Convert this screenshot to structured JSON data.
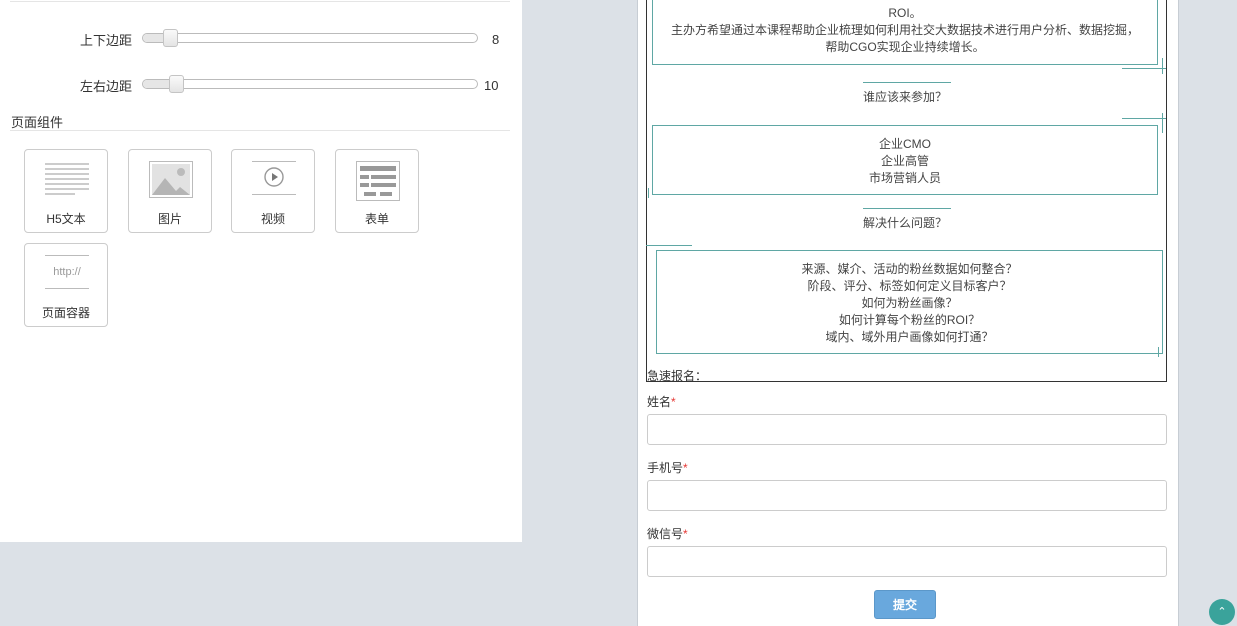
{
  "settings": {
    "vertical_margin": {
      "label": "上下边距",
      "value": "8",
      "level_percent": 8
    },
    "horizontal_margin": {
      "label": "左右边距",
      "value": "10",
      "level_percent": 10
    }
  },
  "components": {
    "title": "页面组件",
    "items": [
      {
        "label": "H5文本",
        "icon": "text-lines-icon"
      },
      {
        "label": "图片",
        "icon": "image-icon"
      },
      {
        "label": "视频",
        "icon": "video-play-icon"
      },
      {
        "label": "表单",
        "icon": "form-icon"
      },
      {
        "label": "页面容器",
        "icon": "browser-url-icon",
        "icon_text": "http://"
      }
    ]
  },
  "preview": {
    "intro_lines": [
      "ROI。",
      "主办方希望通过本课程帮助企业梳理如何利用社交大数据技术进行用户分析、数据挖掘，",
      "帮助CGO实现企业持续增长。"
    ],
    "who_heading": "谁应该来参加？",
    "who_lines": [
      "企业CMO",
      "企业高管",
      "市场营销人员"
    ],
    "problem_heading": "解决什么问题？",
    "problem_lines": [
      "来源、媒介、活动的粉丝数据如何整合？",
      "阶段、评分、标签如何定义目标客户？",
      "如何为粉丝画像？",
      "如何计算每个粉丝的ROI？",
      "域内、域外用户画像如何打通？"
    ],
    "signup_title": "急速报名："
  },
  "form": {
    "fields": [
      {
        "label": "姓名",
        "required_mark": "*",
        "value": ""
      },
      {
        "label": "手机号",
        "required_mark": "*",
        "value": ""
      },
      {
        "label": "微信号",
        "required_mark": "*",
        "value": ""
      }
    ],
    "submit_label": "提交"
  },
  "scroll_top_icon": "chevron-up-icon",
  "colors": {
    "accent_teal": "#5fa7a4",
    "submit_blue": "#69a8dd",
    "required_red": "#e53935",
    "page_background": "#dce1e7"
  }
}
